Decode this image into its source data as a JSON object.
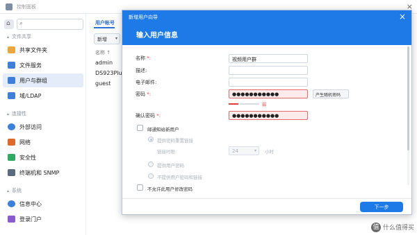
{
  "window": {
    "title": "控制面板",
    "close_glyph": "×"
  },
  "sidebar": {
    "search_glyph": "⌕",
    "home_glyph": "⌂",
    "sections": [
      {
        "label": "文件共享"
      },
      {
        "label": "连接性"
      },
      {
        "label": "系统"
      }
    ],
    "items": [
      {
        "label": "共享文件夹",
        "icon": "shared-folder-icon",
        "color": "#f0a640"
      },
      {
        "label": "文件服务",
        "icon": "file-services-icon",
        "color": "#3d7fd9"
      },
      {
        "label": "用户与群组",
        "icon": "user-group-icon",
        "color": "#3d7fd9",
        "active": true
      },
      {
        "label": "域/LDAP",
        "icon": "domain-ldap-icon",
        "color": "#3d7fd9"
      },
      {
        "label": "外部访问",
        "icon": "external-access-icon",
        "color": "#3d7fd9"
      },
      {
        "label": "网络",
        "icon": "network-icon",
        "color": "#e06a2e"
      },
      {
        "label": "安全性",
        "icon": "security-icon",
        "color": "#2eaa62"
      },
      {
        "label": "终端机和 SNMP",
        "icon": "terminal-snmp-icon",
        "color": "#5a6b80"
      },
      {
        "label": "信息中心",
        "icon": "info-center-icon",
        "color": "#3d7fd9"
      },
      {
        "label": "登录门户",
        "icon": "login-portal-icon",
        "color": "#8a5ad0"
      }
    ]
  },
  "content": {
    "tab": "用户帐号",
    "create_button": "新增",
    "create_caret": "▾",
    "column_header": "名称",
    "sort_glyph": "↑",
    "rows": [
      "admin",
      "DS923Plus",
      "guest"
    ]
  },
  "dialog": {
    "window_title": "新增用户向导",
    "close_glyph": "×",
    "heading": "输入用户信息",
    "fields": {
      "name": {
        "label": "名称",
        "required_mark": "*:",
        "value": "视频用户群"
      },
      "description": {
        "label": "描述:",
        "value": ""
      },
      "email": {
        "label": "电子邮件:",
        "value": ""
      },
      "password": {
        "label": "密码",
        "required_mark": "*:",
        "value": "●●●●●●●●●●●"
      },
      "confirm_password": {
        "label": "确认密码",
        "required_mark": "*:",
        "value": "●●●●●●●●●●●"
      }
    },
    "generate_password_button": "产生随机密码",
    "strength_text": "弱",
    "notify_checkbox_label": "邮通知给新用户",
    "options": {
      "send_reset_link": "提供密码重置链接",
      "link_expiry_label": "链接时限:",
      "link_expiry_value": "24",
      "link_expiry_caret": "▾",
      "link_expiry_unit": "小时",
      "provide_password": "提供用户密码",
      "do_not_show_password": "不提供用户密码和链接"
    },
    "disallow_change_label": "不允许此用户修改密码",
    "next_button": "下一步"
  },
  "watermark": {
    "icon_text": "值",
    "text": "什么值得买"
  }
}
